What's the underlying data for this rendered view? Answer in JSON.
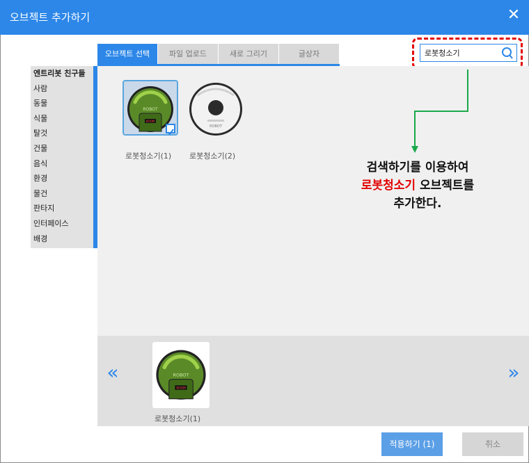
{
  "dialog": {
    "title": "오브젝트 추가하기",
    "close_label": "✕"
  },
  "tabs": [
    {
      "label": "오브젝트 선택",
      "active": true
    },
    {
      "label": "파일 업로드",
      "active": false
    },
    {
      "label": "새로 그리기",
      "active": false
    },
    {
      "label": "글상자",
      "active": false
    }
  ],
  "search": {
    "value": "로봇청소기",
    "placeholder": ""
  },
  "sidebar": {
    "items": [
      {
        "label": "엔트리봇 친구들"
      },
      {
        "label": "사람"
      },
      {
        "label": "동물"
      },
      {
        "label": "식물"
      },
      {
        "label": "탈것"
      },
      {
        "label": "건물"
      },
      {
        "label": "음식"
      },
      {
        "label": "환경"
      },
      {
        "label": "물건"
      },
      {
        "label": "판타지"
      },
      {
        "label": "인터페이스"
      },
      {
        "label": "배경"
      }
    ]
  },
  "objects": [
    {
      "label": "로봇청소기(1)",
      "selected": true,
      "logo": "ROBOT",
      "display": "BOOM"
    },
    {
      "label": "로봇청소기(2)",
      "selected": false,
      "logo": "ROBOT"
    }
  ],
  "annotation": {
    "line1": "검색하기를 이용하여",
    "line2_red": "로봇청소기",
    "line2_rest": " 오브젝트를",
    "line3": "추가한다."
  },
  "selected_tray": {
    "items": [
      {
        "label": "로봇청소기(1)",
        "logo": "ROBOT",
        "display": "BOOM"
      }
    ],
    "prev_icon": "«",
    "next_icon": "»"
  },
  "footer": {
    "apply_label": "적용하기 (1)",
    "cancel_label": "취소"
  },
  "colors": {
    "accent": "#2c87e8",
    "highlight": "#e20000",
    "callout_arrow": "#1aa84a",
    "robot_green": "#5a8a28"
  }
}
